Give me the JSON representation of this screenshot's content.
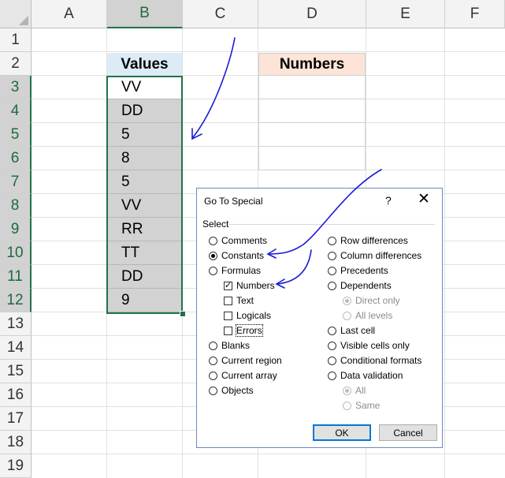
{
  "columns": [
    "A",
    "B",
    "C",
    "D",
    "E",
    "F"
  ],
  "rows": [
    "1",
    "2",
    "3",
    "4",
    "5",
    "6",
    "7",
    "8",
    "9",
    "10",
    "11",
    "12",
    "13",
    "14",
    "15",
    "16",
    "17",
    "18",
    "19"
  ],
  "values_header": "Values",
  "values": [
    "VV",
    "DD",
    "5",
    "8",
    "5",
    "VV",
    "RR",
    "TT",
    "DD",
    "9"
  ],
  "numbers_header": "Numbers",
  "colors": {
    "selection_green": "#217346",
    "arrow": "#1a1ad6",
    "values_header_bg": "#ddebf7",
    "numbers_header_bg": "#fce4d6"
  },
  "dialog": {
    "title": "Go To Special",
    "help": "?",
    "close": "✕",
    "select_label": "Select",
    "left_options": {
      "comments": "Comments",
      "constants": "Constants",
      "formulas": "Formulas",
      "numbers": "Numbers",
      "text": "Text",
      "logicals": "Logicals",
      "errors": "Errors",
      "blanks": "Blanks",
      "current_region": "Current region",
      "current_array": "Current array",
      "objects": "Objects"
    },
    "right_options": {
      "row_differences": "Row differences",
      "column_differences": "Column differences",
      "precedents": "Precedents",
      "dependents": "Dependents",
      "direct_only": "Direct only",
      "all_levels": "All levels",
      "last_cell": "Last cell",
      "visible_cells_only": "Visible cells only",
      "conditional_formats": "Conditional formats",
      "data_validation": "Data validation",
      "all": "All",
      "same": "Same"
    },
    "selected_option": "Constants",
    "checked_options": [
      "Numbers"
    ],
    "ok_label": "OK",
    "cancel_label": "Cancel"
  }
}
